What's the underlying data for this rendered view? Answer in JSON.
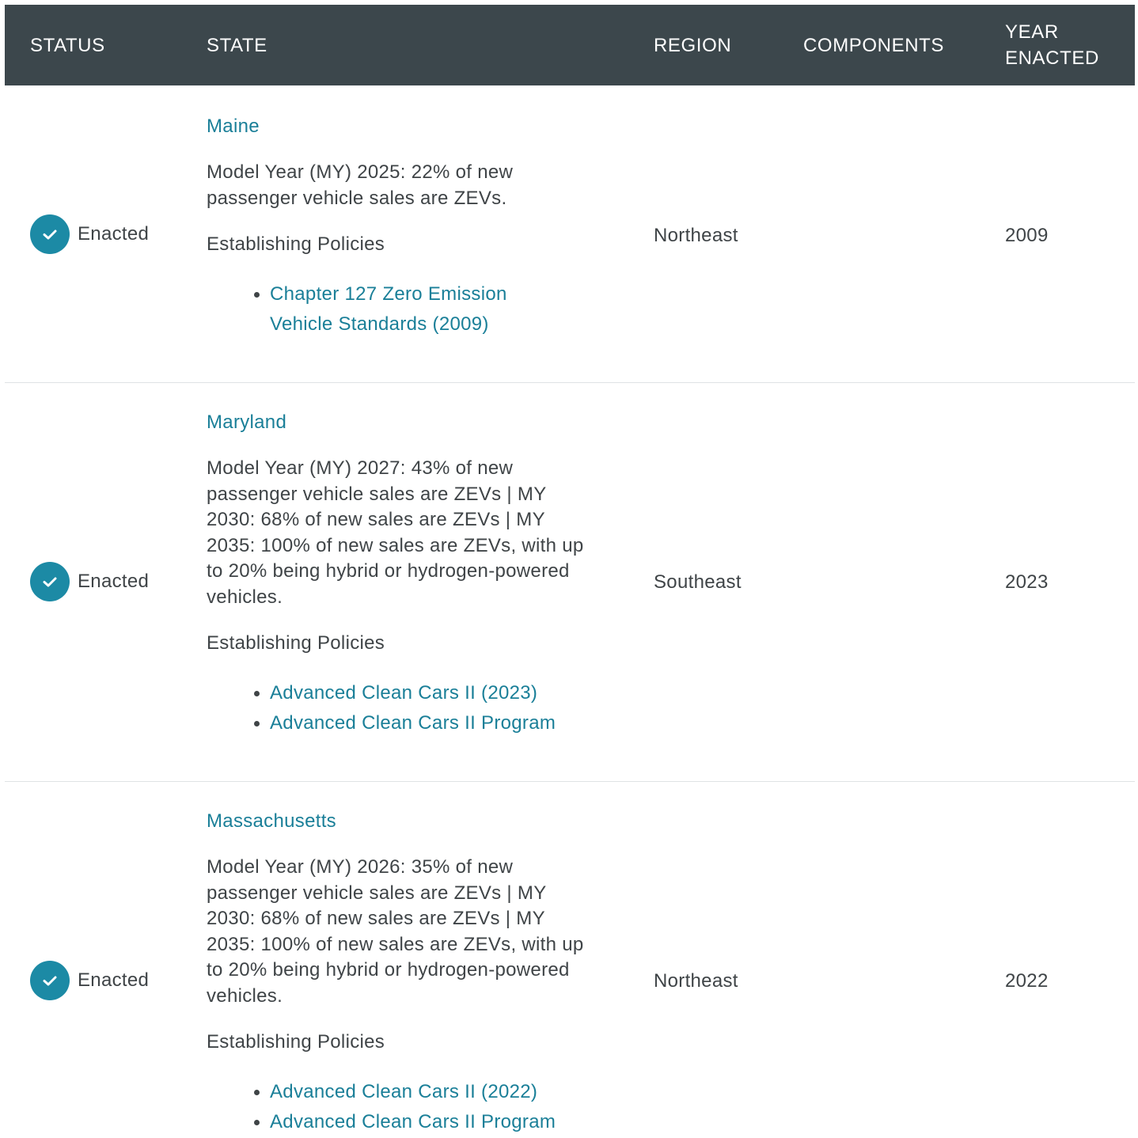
{
  "header": {
    "status": "STATUS",
    "state": "STATE",
    "region": "REGION",
    "components": "COMPONENTS",
    "year_line1": "YEAR",
    "year_line2": "ENACTED"
  },
  "colors": {
    "header_bg": "#3c474c",
    "link": "#1a7f98",
    "check_icon_bg": "#1c8aa5"
  },
  "rows": [
    {
      "status": "Enacted",
      "status_icon": "check-circle-icon",
      "state": "Maine",
      "description": "Model Year (MY) 2025: 22% of new passenger vehicle sales are ZEVs.",
      "establishing_label": "Establishing Policies",
      "policies": [
        "Chapter 127 Zero Emission Vehicle Standards (2009)"
      ],
      "region": "Northeast",
      "components": "",
      "year": "2009"
    },
    {
      "status": "Enacted",
      "status_icon": "check-circle-icon",
      "state": "Maryland",
      "description": "Model Year (MY) 2027: 43% of new passenger vehicle sales are ZEVs | MY 2030: 68% of new sales are ZEVs | MY 2035: 100% of new sales are ZEVs, with up to 20% being hybrid or hydrogen-powered vehicles.",
      "establishing_label": "Establishing Policies",
      "policies": [
        "Advanced Clean Cars II (2023)",
        "Advanced Clean Cars II Program"
      ],
      "region": "Southeast",
      "components": "",
      "year": "2023"
    },
    {
      "status": "Enacted",
      "status_icon": "check-circle-icon",
      "state": "Massachusetts",
      "description": "Model Year (MY) 2026: 35% of new passenger vehicle sales are ZEVs | MY 2030: 68% of new sales are ZEVs | MY 2035: 100% of new sales are ZEVs, with up to 20% being hybrid or hydrogen-powered vehicles.",
      "establishing_label": "Establishing Policies",
      "policies": [
        "Advanced Clean Cars II (2022)",
        "Advanced Clean Cars II Program"
      ],
      "region": "Northeast",
      "components": "",
      "year": "2022"
    }
  ]
}
